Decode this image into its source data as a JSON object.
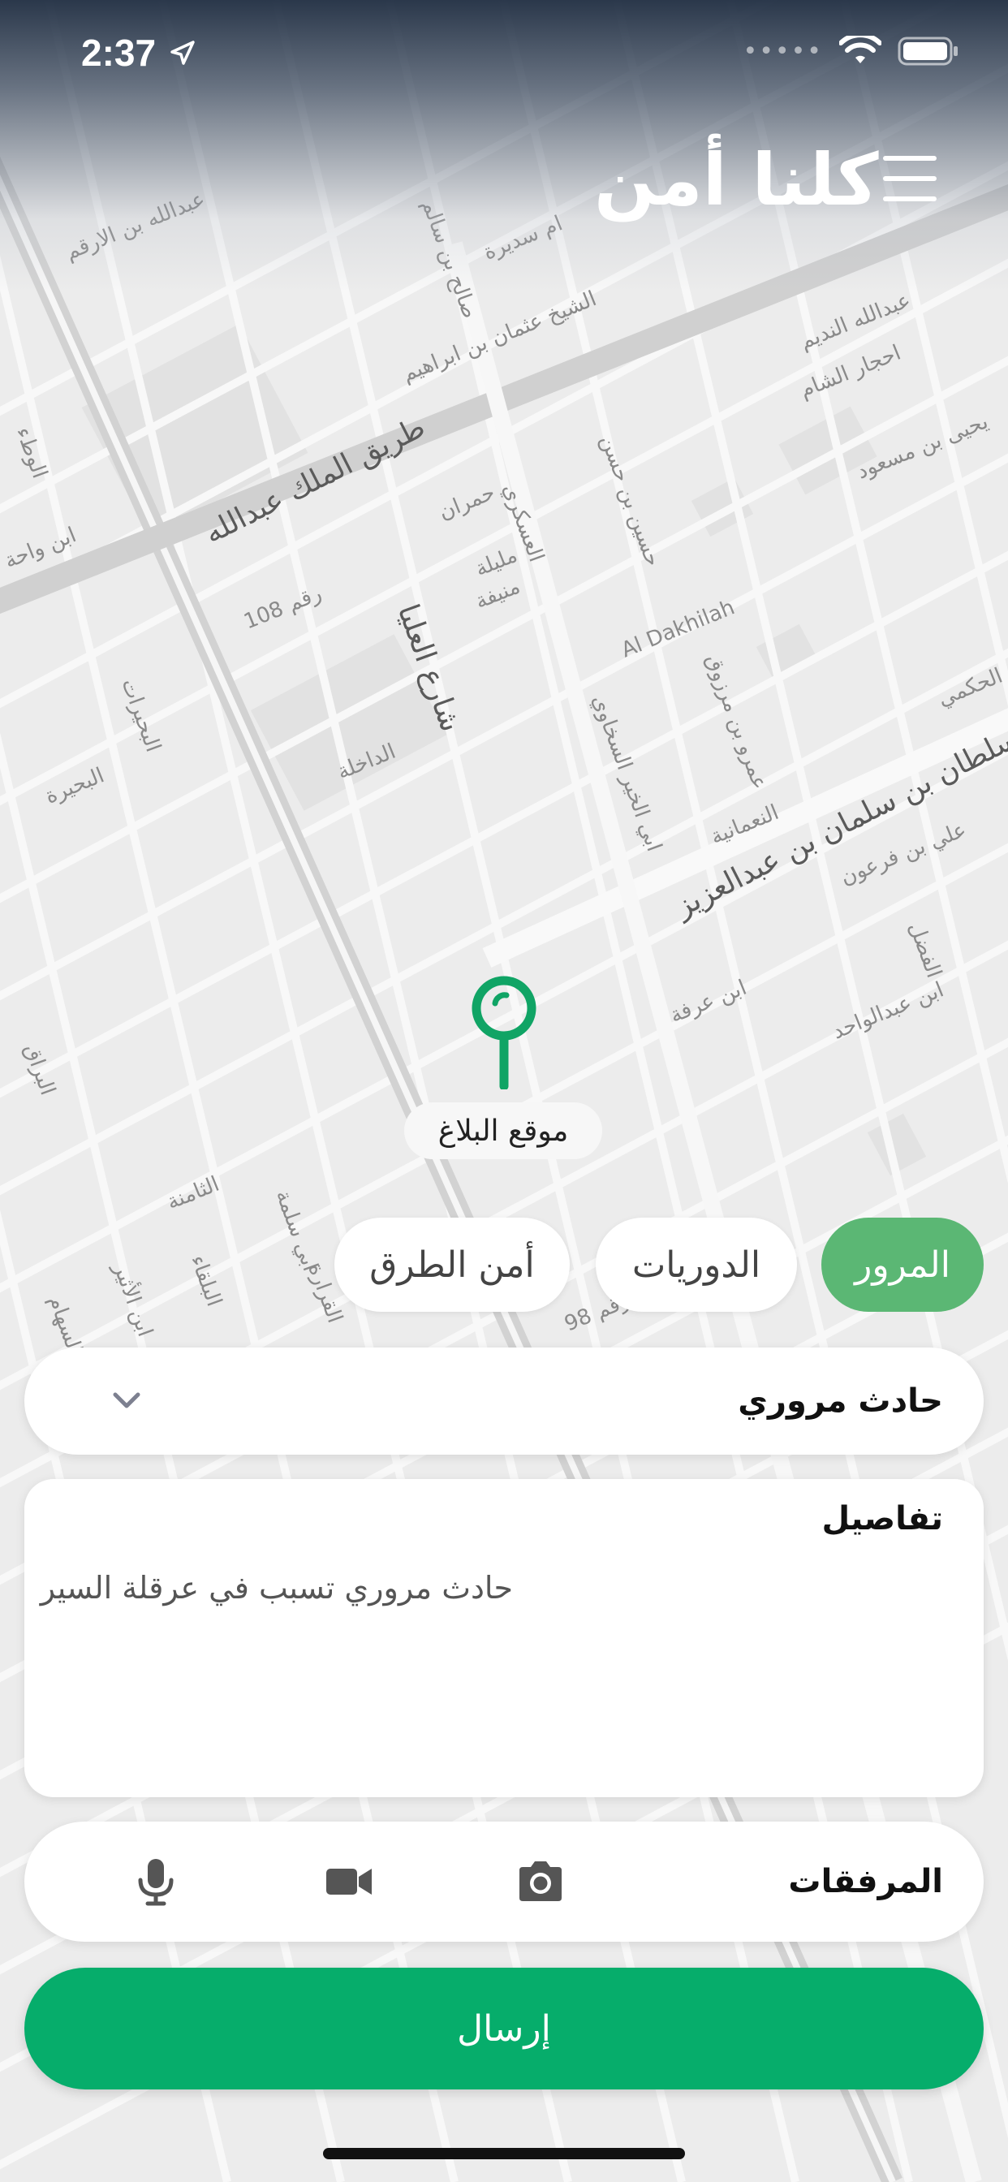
{
  "status_bar": {
    "time": "2:37"
  },
  "header": {
    "logo_text": "كلنا أمن"
  },
  "map": {
    "marker_label": "موقع البلاغ",
    "streets": [
      "طريق الملك عبدالله",
      "شارع العليا",
      "الأمير سلطان بن سلمان بن عبدالعزيز",
      "Al Dakhilah",
      "الداخلة",
      "رقم 108",
      "عبدالله بن الارقم",
      "الشيخ عثمان بن ابراهيم",
      "ابن واحة",
      "البحيرات",
      "البحيرة",
      "ام سديرة",
      "صالح بن سالم",
      "حسين بن حسن",
      "عمرو بن مرزوق",
      "علي بن فرعون",
      "ابن عرفة",
      "يحيى بن مسعود",
      "عبدالله النديم",
      "احجار الشام",
      "الثامنة",
      "ابن الأثير",
      "ابي سلمة",
      "السهام",
      "رقم 98",
      "النعمانية",
      "الحكمي",
      "الفضل",
      "ابن عبدالواحد",
      "الوطء",
      "مليلة",
      "منيفة",
      "حمران",
      "البلقاء",
      "القرارة",
      "البراق",
      "العسكري",
      "ابي الخير السخاوي"
    ]
  },
  "categories": [
    {
      "label": "المرور",
      "active": true
    },
    {
      "label": "الدوريات",
      "active": false
    },
    {
      "label": "أمن الطرق",
      "active": false
    }
  ],
  "report_type": {
    "selected": "حادث مروري"
  },
  "details": {
    "title": "تفاصيل",
    "text": "حادث مروري تسبب في عرقلة السير"
  },
  "attachments": {
    "label": "المرفقات",
    "icons": [
      "camera-icon",
      "video-camera-icon",
      "microphone-icon"
    ]
  },
  "submit": {
    "label": "إرسال"
  },
  "colors": {
    "accent_green": "#06ad6b",
    "chip_active": "#5bb774",
    "marker_green": "#10a465"
  }
}
